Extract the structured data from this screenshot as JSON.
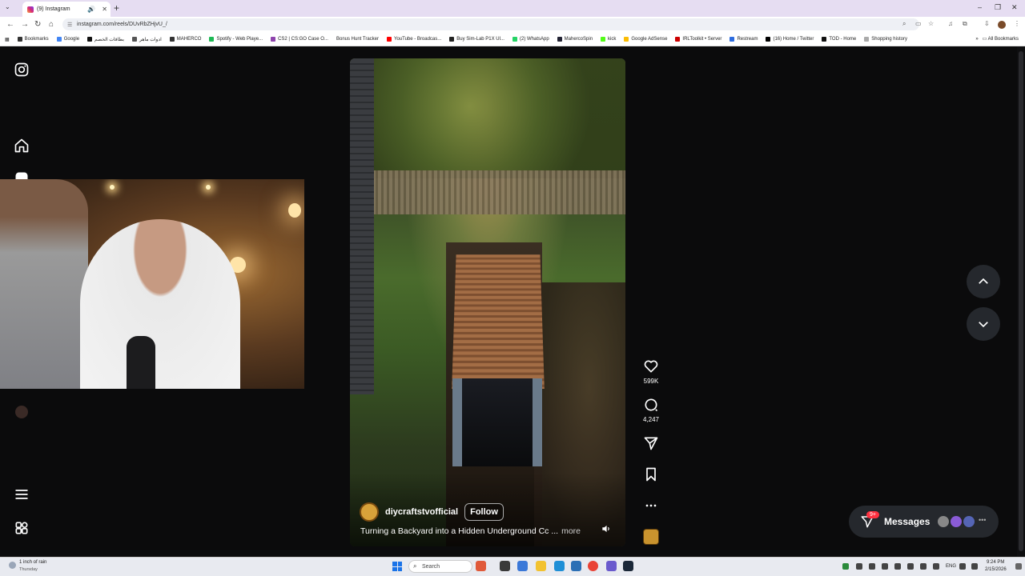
{
  "browser": {
    "tab_title": "(9) Instagram",
    "url": "instagram.com/reels/DUvRbZHjvU_/",
    "new_tab": "+",
    "bookmarks": [
      "Bookmarks",
      "Google",
      "بطاقات الخصم",
      "ادوات ماهر",
      "MAHERCO",
      "Spotify - Web Playe...",
      "CS2 | CS:GO Case O...",
      "Bonus Hunt Tracker",
      "YouTube - Broadcas...",
      "Buy Sim-Lab P1X Ul...",
      "(2) WhatsApp",
      "MahercoSpin",
      "kick",
      "Google AdSense",
      "IRLToolkit • Server",
      "Restream",
      "(16) Home / Twitter",
      "TOD - Home",
      "Shopping history"
    ],
    "all_bookmarks": "All Bookmarks"
  },
  "reel": {
    "author": "diycraftstvofficial",
    "follow_label": "Follow",
    "caption": "Turning a Backyard into a Hidden Underground Cc ...",
    "more_label": "more",
    "likes": "599K",
    "comments": "4,247"
  },
  "messages": {
    "label": "Messages",
    "badge": "9+"
  },
  "taskbar": {
    "weather_title": "1 inch of rain",
    "weather_sub": "Thursday",
    "search_placeholder": "Search",
    "lang": "ENG",
    "time": "9:24 PM",
    "date": "2/15/2026"
  },
  "colors": {
    "page_bg": "#0b0b0c",
    "badge": "#ff3040",
    "button_bg": "#25282d"
  }
}
